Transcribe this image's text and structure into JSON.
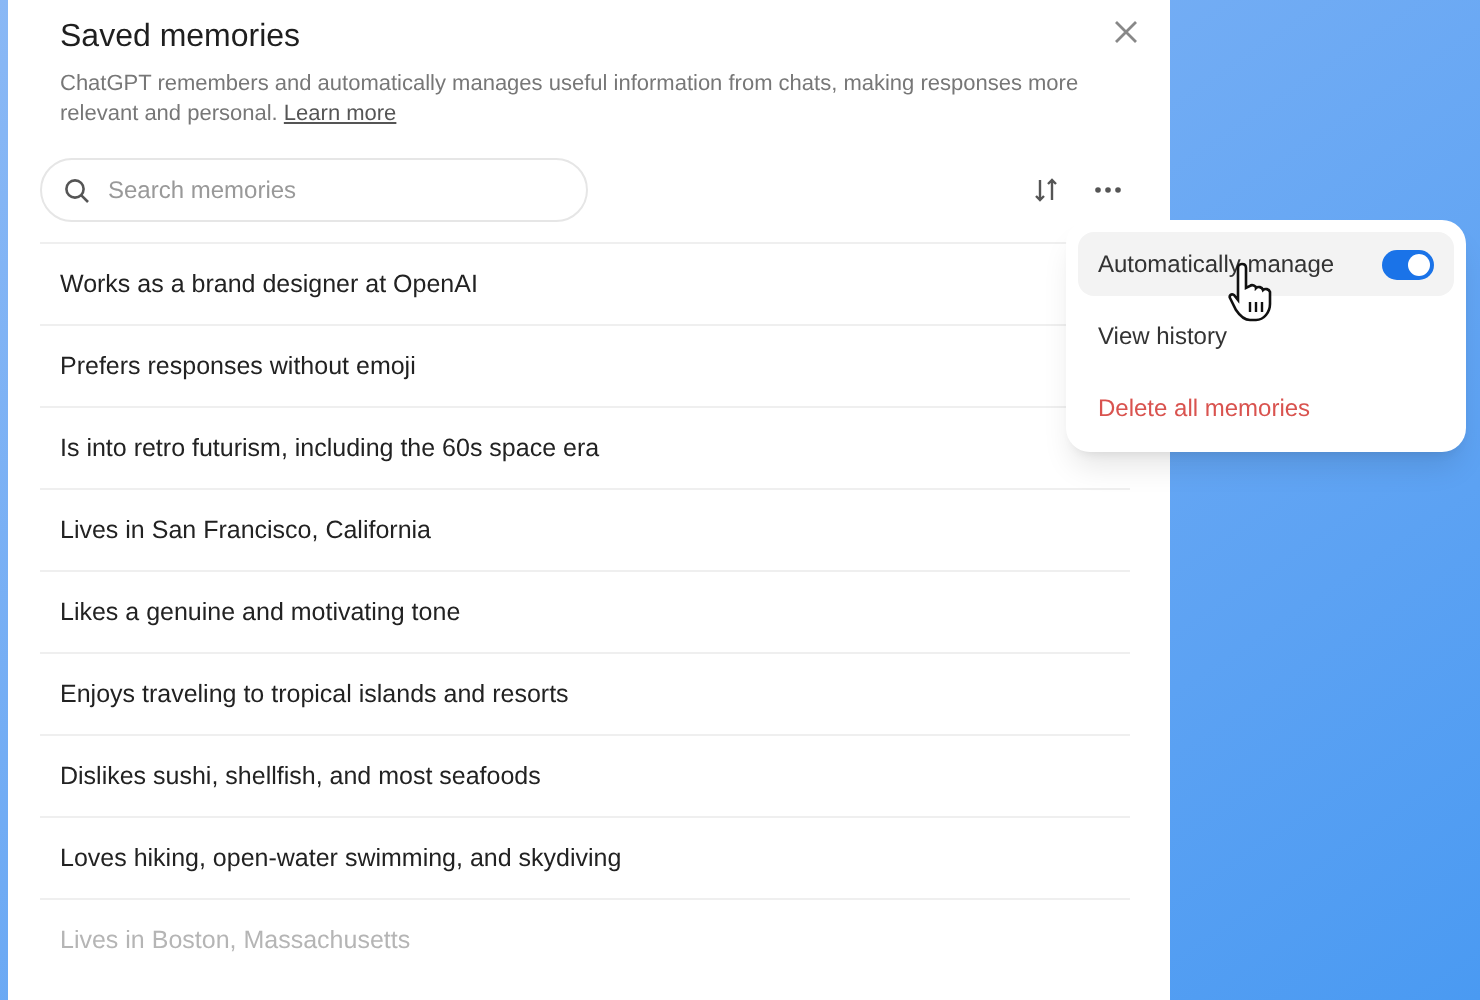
{
  "dialog": {
    "title": "Saved memories",
    "description": "ChatGPT remembers and automatically manages useful information from chats, making responses more relevant and personal.",
    "learn_more": "Learn more"
  },
  "search": {
    "placeholder": "Search memories"
  },
  "memories": [
    {
      "text": "Works as a brand designer at OpenAI",
      "faded": false
    },
    {
      "text": "Prefers responses without emoji",
      "faded": false
    },
    {
      "text": "Is into retro futurism, including the 60s space era",
      "faded": false
    },
    {
      "text": "Lives in San Francisco, California",
      "faded": false
    },
    {
      "text": "Likes a genuine and motivating tone",
      "faded": false
    },
    {
      "text": "Enjoys traveling to tropical islands and resorts",
      "faded": false
    },
    {
      "text": "Dislikes sushi, shellfish, and most seafoods",
      "faded": false
    },
    {
      "text": "Loves hiking, open-water swimming, and skydiving",
      "faded": false
    },
    {
      "text": "Lives in Boston, Massachusetts",
      "faded": true
    }
  ],
  "menu": [
    {
      "kind": "toggle",
      "label": "Automatically manage",
      "on": true,
      "hovered": true
    },
    {
      "kind": "item",
      "label": "View history",
      "hovered": false
    },
    {
      "kind": "danger",
      "label": "Delete all memories",
      "hovered": false
    }
  ]
}
